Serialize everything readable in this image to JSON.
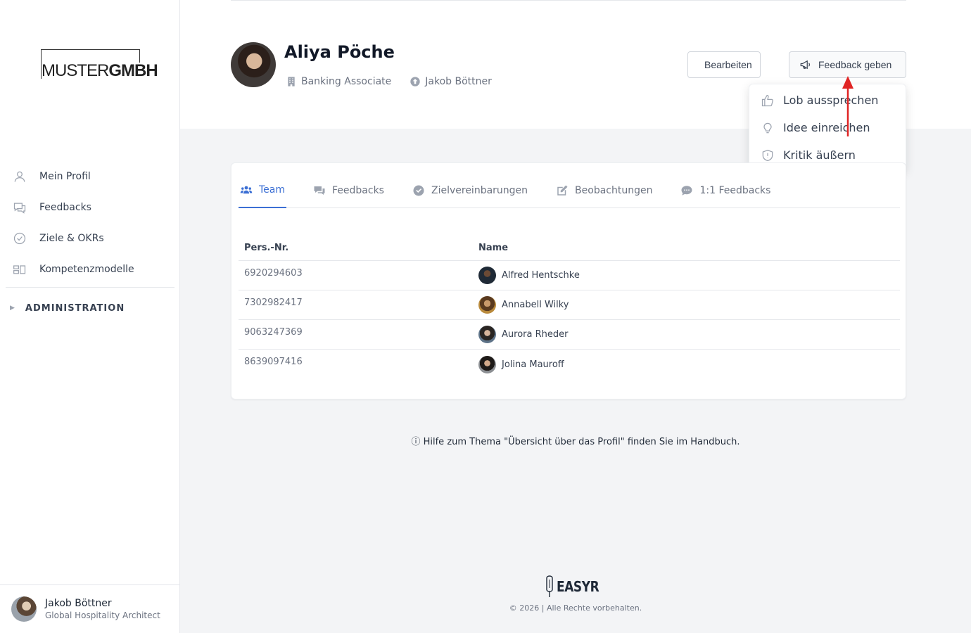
{
  "sidebar": {
    "logo": {
      "part1": "MUSTER",
      "part2": "GMBH"
    },
    "items": [
      {
        "label": "Mein Profil",
        "icon": "user-icon"
      },
      {
        "label": "Feedbacks",
        "icon": "chat-icon"
      },
      {
        "label": "Ziele & OKRs",
        "icon": "check-circle-icon"
      },
      {
        "label": "Kompetenzmodelle",
        "icon": "grid-icon"
      }
    ],
    "admin_label": "ADMINISTRATION",
    "user": {
      "name": "Jakob Böttner",
      "role": "Global Hospitality Architect"
    }
  },
  "profile": {
    "name": "Aliya Pöche",
    "position": "Banking Associate",
    "manager": "Jakob Böttner"
  },
  "actions": {
    "edit_label": "Bearbeiten",
    "feedback_label": "Feedback geben"
  },
  "dropdown": {
    "items": [
      {
        "label": "Lob aussprechen",
        "icon": "thumbs-up-icon"
      },
      {
        "label": "Idee einreichen",
        "icon": "lightbulb-icon"
      },
      {
        "label": "Kritik äußern",
        "icon": "shield-icon"
      }
    ]
  },
  "tabs": [
    {
      "label": "Team",
      "icon": "users-icon",
      "active": true
    },
    {
      "label": "Feedbacks",
      "icon": "chat-icon",
      "active": false
    },
    {
      "label": "Zielvereinbarungen",
      "icon": "check-circle-icon",
      "active": false
    },
    {
      "label": "Beobachtungen",
      "icon": "edit-icon",
      "active": false
    },
    {
      "label": "1:1 Feedbacks",
      "icon": "comment-icon",
      "active": false
    }
  ],
  "table": {
    "headers": {
      "number": "Pers.-Nr.",
      "name": "Name"
    },
    "rows": [
      {
        "number": "6920294603",
        "name": "Alfred Hentschke"
      },
      {
        "number": "7302982417",
        "name": "Annabell Wilky"
      },
      {
        "number": "9063247369",
        "name": "Aurora Rheder"
      },
      {
        "number": "8639097416",
        "name": "Jolina Mauroff"
      }
    ]
  },
  "help": {
    "text": "Hilfe zum Thema \"Übersicht über das Profil\" finden Sie im Handbuch."
  },
  "footer": {
    "brand": "EASYR",
    "copyright": "© 2026 | Alle Rechte vorbehalten."
  },
  "colors": {
    "accent": "#3b6fd4",
    "arrow": "#e02424"
  }
}
